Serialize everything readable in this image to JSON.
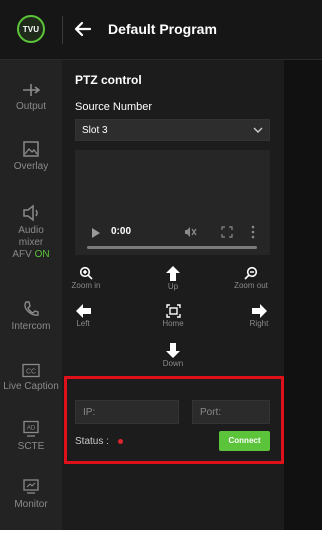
{
  "header": {
    "logo_text": "TVU",
    "title": "Default Program"
  },
  "sidebar": {
    "items": [
      {
        "label": "Output"
      },
      {
        "label": "Overlay"
      },
      {
        "label_lines": [
          "Audio",
          "mixer"
        ],
        "afv_label": "AFV",
        "afv_state": "ON"
      },
      {
        "label": "Intercom"
      },
      {
        "label": "Live Caption",
        "icon_text": "CC"
      },
      {
        "label": "SCTE",
        "icon_text": "AD"
      },
      {
        "label": "Monitor"
      }
    ]
  },
  "ptz": {
    "title": "PTZ control",
    "source_label": "Source Number",
    "source_value": "Slot 3",
    "video_time": "0:00",
    "controls": {
      "zoom_in": "Zoom in",
      "up": "Up",
      "zoom_out": "Zoom out",
      "left": "Left",
      "home": "Home",
      "right": "Right",
      "down": "Down"
    },
    "ip_placeholder": "IP:",
    "port_placeholder": "Port:",
    "status_label": "Status :",
    "connect_label": "Connect"
  },
  "colors": {
    "accent": "#5cc43a",
    "highlight": "#e0101a",
    "status_dot": "#e0242e"
  }
}
